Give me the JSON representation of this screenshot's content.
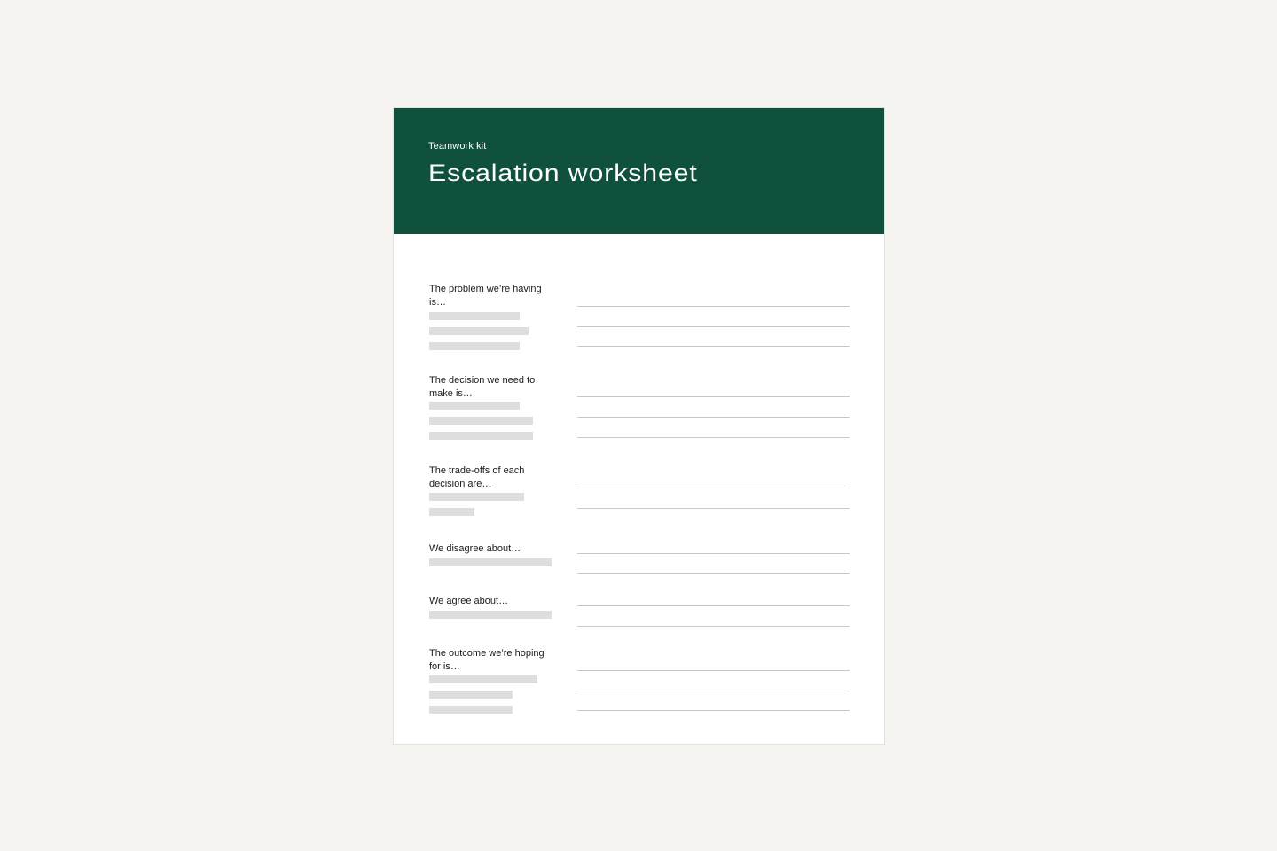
{
  "colors": {
    "background": "#F5F4F0",
    "header": "#10513D",
    "placeholder_bar": "#DEDEDE",
    "rule": "#C8C8C8"
  },
  "header": {
    "eyebrow": "Teamwork kit",
    "title": "Escalation worksheet"
  },
  "sections": [
    {
      "label": "The problem we’re having is…"
    },
    {
      "label": "The decision we need to make is…"
    },
    {
      "label": "The trade-offs of each decision are…"
    },
    {
      "label": "We disagree about…"
    },
    {
      "label": "We agree about…"
    },
    {
      "label": "The outcome we’re hoping for is…"
    }
  ]
}
